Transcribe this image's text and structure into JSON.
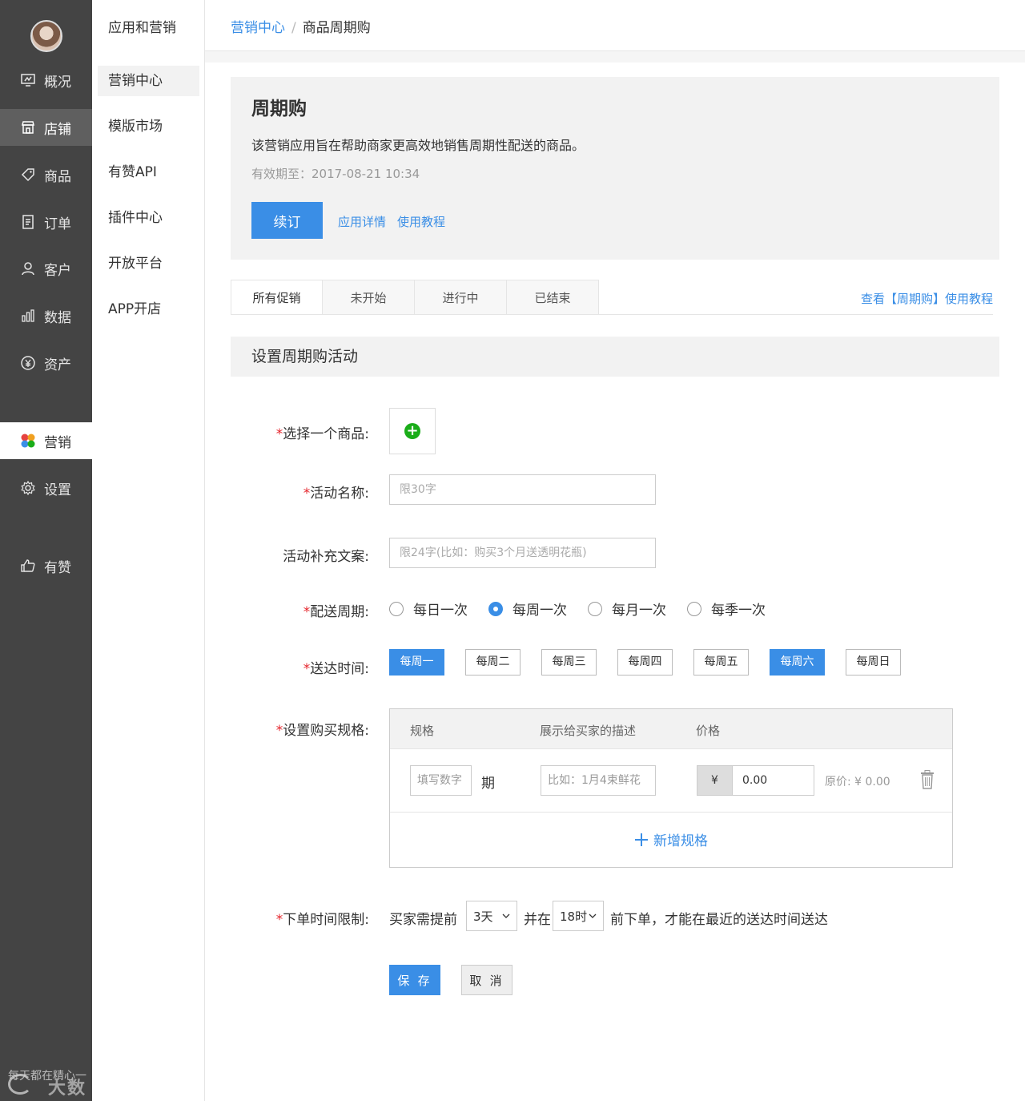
{
  "nav": {
    "items": [
      {
        "label": "概况",
        "icon": "monitor-icon"
      },
      {
        "label": "店铺",
        "icon": "store-icon"
      },
      {
        "label": "商品",
        "icon": "tag-icon"
      },
      {
        "label": "订单",
        "icon": "order-icon"
      },
      {
        "label": "客户",
        "icon": "user-icon"
      },
      {
        "label": "数据",
        "icon": "bar-chart-icon"
      },
      {
        "label": "资产",
        "icon": "yen-icon"
      },
      {
        "label": "营销",
        "icon": "flower-icon"
      },
      {
        "label": "设置",
        "icon": "gear-icon"
      },
      {
        "label": "有赞",
        "icon": "thumbs-up-icon"
      }
    ],
    "watermark": "每天都在精心一",
    "watermark_brand": "大数跨境"
  },
  "subnav": {
    "title": "应用和营销",
    "items": [
      "营销中心",
      "模版市场",
      "有赞API",
      "插件中心",
      "开放平台",
      "APP开店"
    ]
  },
  "breadcrumb": {
    "parent": "营销中心",
    "sep": "/",
    "current": "商品周期购"
  },
  "intro": {
    "title": "周期购",
    "desc": "该营销应用旨在帮助商家更高效地销售周期性配送的商品。",
    "valid": "有效期至：2017-08-21 10:34",
    "renew": "续订",
    "link_detail": "应用详情",
    "link_tutorial": "使用教程"
  },
  "tabs": [
    "所有促销",
    "未开始",
    "进行中",
    "已结束"
  ],
  "tab_help": "查看【周期购】使用教程",
  "section_title": "设置周期购活动",
  "form": {
    "product_label": "选择一个商品:",
    "name_label": "活动名称:",
    "name_placeholder": "限30字",
    "extra_label": "活动补充文案:",
    "extra_placeholder": "限24字(比如：购买3个月送透明花瓶)",
    "cycle_label": "配送周期:",
    "cycles": [
      "每日一次",
      "每周一次",
      "每月一次",
      "每季一次"
    ],
    "cycle_selected": 1,
    "deliver_label": "送达时间:",
    "days": [
      "每周一",
      "每周二",
      "每周三",
      "每周四",
      "每周五",
      "每周六",
      "每周日"
    ],
    "days_on": [
      0,
      5
    ],
    "spec_label": "设置购买规格:",
    "spec_head": {
      "spec": "规格",
      "desc": "展示给买家的描述",
      "price": "价格"
    },
    "spec_row": {
      "num_placeholder": "填写数字",
      "unit": "期",
      "desc_placeholder": "比如：1月4束鲜花",
      "currency": "¥",
      "price_value": "0.00",
      "original": "原价: ¥ 0.00"
    },
    "add_spec": "新增规格",
    "limit_label": "下单时间限制:",
    "limit_prefix": "买家需提前",
    "days_select": "3天",
    "limit_mid": "并在",
    "hour_select": "18时",
    "limit_suffix": "前下单，才能在最近的送达时间送达",
    "save": "保 存",
    "cancel": "取 消"
  }
}
